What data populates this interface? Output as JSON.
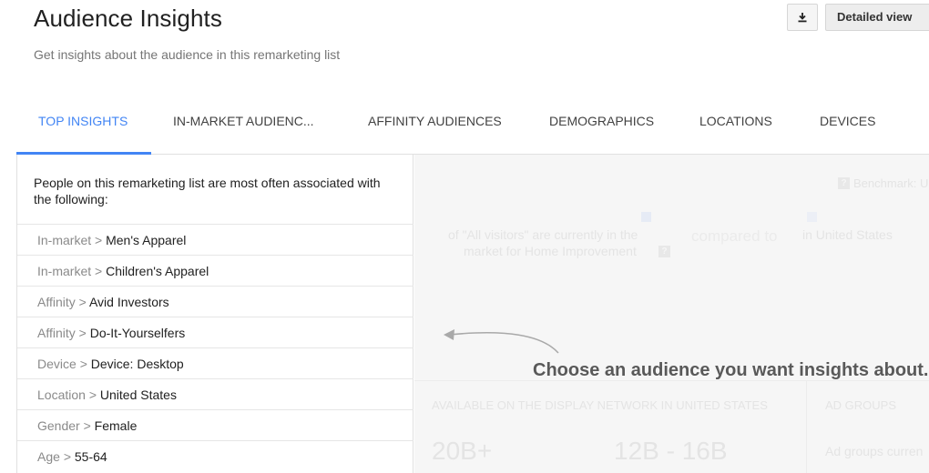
{
  "header": {
    "title": "Audience Insights",
    "subtitle": "Get insights about the audience in this remarketing list",
    "download_icon": "download-icon",
    "detailed_view_label": "Detailed view"
  },
  "tabs": [
    {
      "label": "TOP INSIGHTS",
      "active": true
    },
    {
      "label": "IN-MARKET AUDIENC...",
      "active": false
    },
    {
      "label": "AFFINITY AUDIENCES",
      "active": false
    },
    {
      "label": "DEMOGRAPHICS",
      "active": false
    },
    {
      "label": "LOCATIONS",
      "active": false
    },
    {
      "label": "DEVICES",
      "active": false
    }
  ],
  "insights": {
    "intro": "People on this remarketing list are most often associated with the following:",
    "separator": ">",
    "items": [
      {
        "category": "In-market",
        "value": "Men's Apparel"
      },
      {
        "category": "In-market",
        "value": "Children's Apparel"
      },
      {
        "category": "Affinity",
        "value": "Avid Investors"
      },
      {
        "category": "Affinity",
        "value": "Do-It-Yourselfers"
      },
      {
        "category": "Device",
        "value": "Device: Desktop"
      },
      {
        "category": "Location",
        "value": "United States"
      },
      {
        "category": "Gender",
        "value": "Female"
      },
      {
        "category": "Age",
        "value": "55-64"
      }
    ]
  },
  "placeholder": {
    "benchmark": "Benchmark: U",
    "stat_text_1": "of \"All visitors\" are currently in the",
    "stat_text_2": "market for Home Improvement",
    "compared_to": "compared to",
    "in_us": "in United States",
    "available_label": "AVAILABLE ON THE DISPLAY NETWORK IN UNITED STATES",
    "ad_groups_label": "AD GROUPS",
    "value_1": "20B+",
    "value_2": "12B - 16B",
    "ad_groups_text": "Ad groups curren",
    "choose_message": "Choose an audience you want insights about."
  },
  "colors": {
    "accent": "#4285f4",
    "panel_bg": "#f6f6f6"
  }
}
